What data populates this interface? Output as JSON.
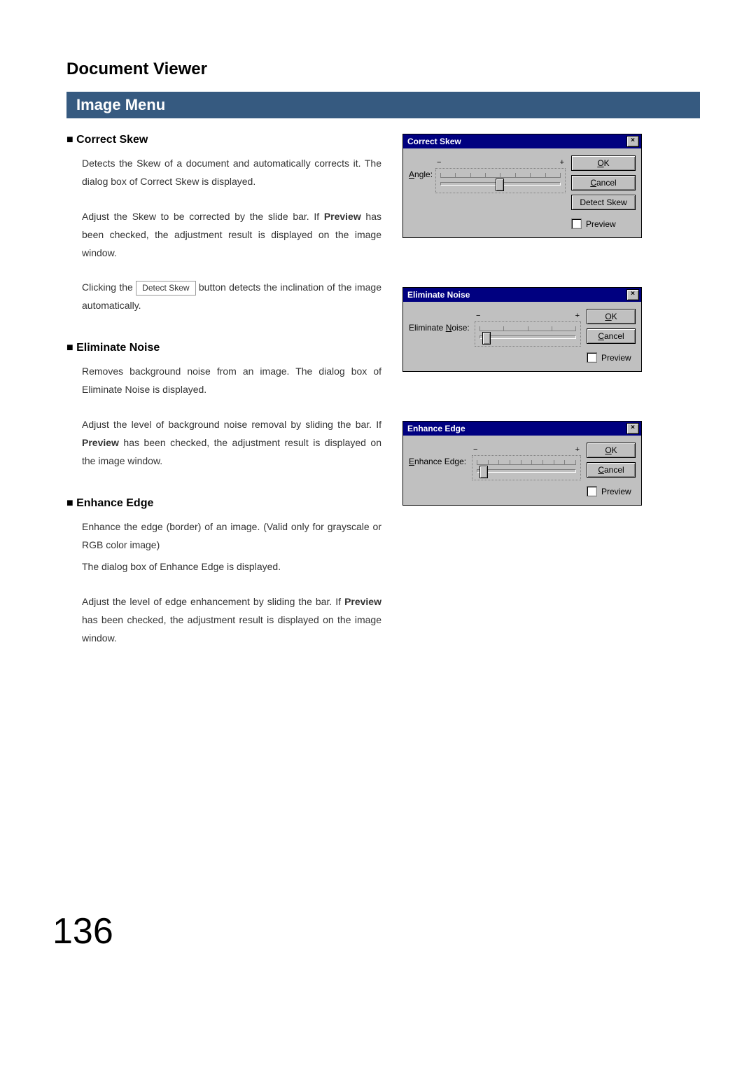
{
  "doc_title": "Document Viewer",
  "section_title": "Image Menu",
  "page_number": "136",
  "sections": [
    {
      "title": "Correct Skew",
      "paras": [
        "Detects the Skew of a document and automatically corrects it.  The dialog box of Correct Skew is displayed.",
        "Adjust the Skew to be corrected by the slide bar.  If Preview has been checked, the adjustment result is displayed on the image window."
      ],
      "tail_before": "Clicking the ",
      "inline_button": "Detect Skew",
      "tail_after": " button detects the inclination of the image automatically."
    },
    {
      "title": "Eliminate Noise",
      "paras": [
        "Removes background noise from an image.  The dialog box of Eliminate Noise is displayed.",
        "Adjust the level of background noise removal by sliding the bar.  If Preview has been checked, the adjustment result is displayed on the image window."
      ]
    },
    {
      "title": "Enhance Edge",
      "paras": [
        "Enhance the edge (border) of an image.  (Valid only for grayscale or RGB color image)",
        "The dialog box of Enhance Edge is displayed.",
        "Adjust the level of edge enhancement by sliding the bar.  If Preview has been checked, the adjustment result is displayed on the image window."
      ]
    }
  ],
  "dialogs": {
    "correct_skew": {
      "title": "Correct Skew",
      "slider_label": "Angle:",
      "minus": "−",
      "plus": "+",
      "ok": "OK",
      "cancel": "Cancel",
      "detect": "Detect Skew",
      "preview": "Preview"
    },
    "eliminate_noise": {
      "title": "Eliminate Noise",
      "slider_label": "Eliminate Noise:",
      "minus": "−",
      "plus": "+",
      "ok": "OK",
      "cancel": "Cancel",
      "preview": "Preview"
    },
    "enhance_edge": {
      "title": "Enhance Edge",
      "slider_label": "Enhance Edge:",
      "minus": "−",
      "plus": "+",
      "ok": "OK",
      "cancel": "Cancel",
      "preview": "Preview"
    }
  }
}
